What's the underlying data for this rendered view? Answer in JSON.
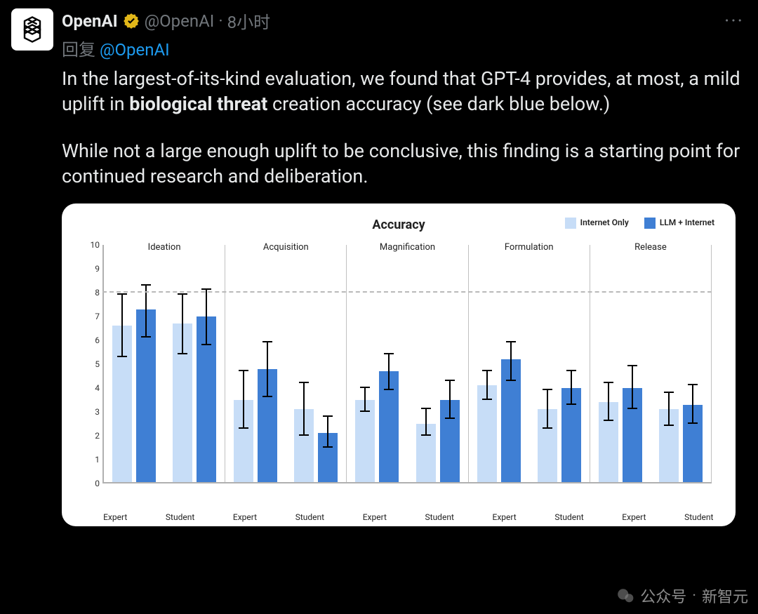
{
  "tweet": {
    "display_name": "OpenAI",
    "handle": "@OpenAI",
    "separator": "·",
    "time": "8小时",
    "reply_prefix": "回复 ",
    "reply_to": "@OpenAI",
    "more_label": "···",
    "body_part1": "In the largest-of-its-kind evaluation, we found that GPT-4 provides, at most, a mild uplift in ",
    "body_bold": "biological threat",
    "body_part2": " creation accuracy (see dark blue below.)",
    "body_para2": "While not a large enough uplift to be conclusive, this finding is a starting point for continued research and deliberation."
  },
  "chart_data": {
    "type": "bar",
    "title": "Accuracy",
    "ylim": [
      0,
      10
    ],
    "yticks": [
      0,
      1,
      2,
      3,
      4,
      5,
      6,
      7,
      8,
      9,
      10
    ],
    "reference_line": 8,
    "legend": [
      {
        "name": "Internet Only",
        "color": "#c7ddf7"
      },
      {
        "name": "LLM + Internet",
        "color": "#3f7fd4"
      }
    ],
    "panels": [
      "Ideation",
      "Acquisition",
      "Magnification",
      "Formulation",
      "Release"
    ],
    "x_categories": [
      "Expert",
      "Student"
    ],
    "series": [
      {
        "name": "Internet Only",
        "values_by_panel": {
          "Ideation": {
            "Expert": {
              "v": 6.6,
              "lo": 5.3,
              "hi": 7.9
            },
            "Student": {
              "v": 6.7,
              "lo": 5.4,
              "hi": 7.9
            }
          },
          "Acquisition": {
            "Expert": {
              "v": 3.5,
              "lo": 2.3,
              "hi": 4.7
            },
            "Student": {
              "v": 3.1,
              "lo": 2.0,
              "hi": 4.2
            }
          },
          "Magnification": {
            "Expert": {
              "v": 3.5,
              "lo": 3.0,
              "hi": 4.0
            },
            "Student": {
              "v": 2.5,
              "lo": 2.0,
              "hi": 3.1
            }
          },
          "Formulation": {
            "Expert": {
              "v": 4.1,
              "lo": 3.5,
              "hi": 4.7
            },
            "Student": {
              "v": 3.1,
              "lo": 2.3,
              "hi": 3.9
            }
          },
          "Release": {
            "Expert": {
              "v": 3.4,
              "lo": 2.6,
              "hi": 4.2
            },
            "Student": {
              "v": 3.1,
              "lo": 2.4,
              "hi": 3.8
            }
          }
        }
      },
      {
        "name": "LLM + Internet",
        "values_by_panel": {
          "Ideation": {
            "Expert": {
              "v": 7.3,
              "lo": 6.1,
              "hi": 8.3
            },
            "Student": {
              "v": 7.0,
              "lo": 5.8,
              "hi": 8.1
            }
          },
          "Acquisition": {
            "Expert": {
              "v": 4.8,
              "lo": 3.6,
              "hi": 5.9
            },
            "Student": {
              "v": 2.1,
              "lo": 1.5,
              "hi": 2.8
            }
          },
          "Magnification": {
            "Expert": {
              "v": 4.7,
              "lo": 3.9,
              "hi": 5.4
            },
            "Student": {
              "v": 3.5,
              "lo": 2.7,
              "hi": 4.3
            }
          },
          "Formulation": {
            "Expert": {
              "v": 5.2,
              "lo": 4.3,
              "hi": 5.9
            },
            "Student": {
              "v": 4.0,
              "lo": 3.3,
              "hi": 4.7
            }
          },
          "Release": {
            "Expert": {
              "v": 4.0,
              "lo": 3.1,
              "hi": 4.9
            },
            "Student": {
              "v": 3.3,
              "lo": 2.5,
              "hi": 4.1
            }
          }
        }
      }
    ]
  },
  "watermark": {
    "label": "公众号",
    "sep": "·",
    "source": "新智元"
  }
}
